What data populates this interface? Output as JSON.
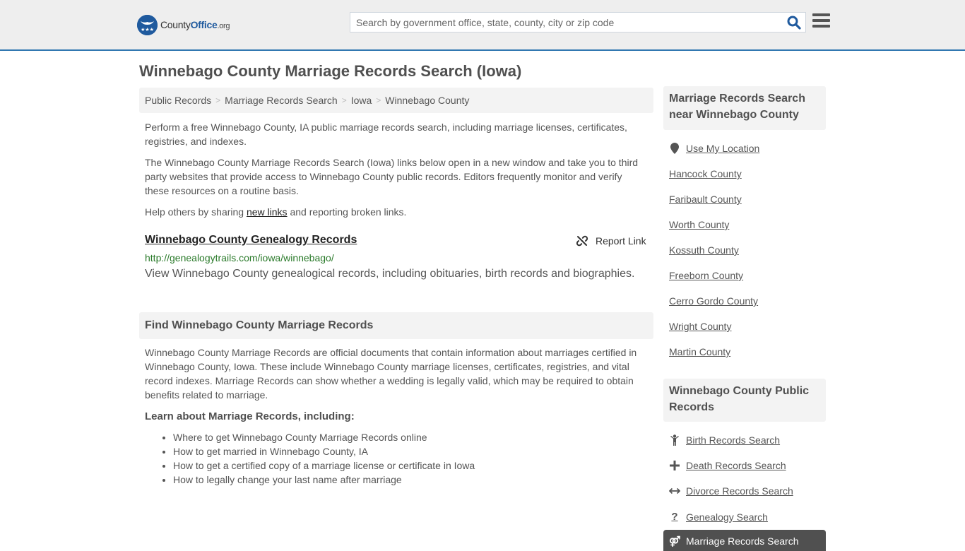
{
  "header": {
    "logo": {
      "name": "County",
      "name_accent": "Office",
      "tld": ".org"
    },
    "search": {
      "placeholder": "Search by government office, state, county, city or zip code",
      "value": ""
    },
    "colors": {
      "brand": "#1f5a9e",
      "header_border": "#3178b1"
    }
  },
  "page": {
    "title": "Winnebago County Marriage Records Search (Iowa)",
    "breadcrumb": [
      "Public Records",
      "Marriage Records Search",
      "Iowa",
      "Winnebago County"
    ],
    "intro": "Perform a free Winnebago County, IA public marriage records search, including marriage licenses, certificates, registries, and indexes.",
    "disclaimer": "The Winnebago County Marriage Records Search (Iowa) links below open in a new window and take you to third party websites that provide access to Winnebago County public records. Editors frequently monitor and verify these resources on a routine basis.",
    "help": {
      "prefix": "Help others by sharing ",
      "link": "new links",
      "suffix": " and reporting broken links."
    }
  },
  "result": {
    "title": "Winnebago County Genealogy Records",
    "report_label": "Report Link",
    "url": "http://genealogytrails.com/iowa/winnebago/",
    "description": "View Winnebago County genealogical records, including obituaries, birth records and biographies."
  },
  "find_section": {
    "heading": "Find Winnebago County Marriage Records",
    "body": "Winnebago County Marriage Records are official documents that contain information about marriages certified in Winnebago County, Iowa. These include Winnebago County marriage licenses, certificates, registries, and vital record indexes. Marriage Records can show whether a wedding is legally valid, which may be required to obtain benefits related to marriage.",
    "learn_heading": "Learn about Marriage Records, including:",
    "bullets": [
      "Where to get Winnebago County Marriage Records online",
      "How to get married in Winnebago County, IA",
      "How to get a certified copy of a marriage license or certificate in Iowa",
      "How to legally change your last name after marriage"
    ]
  },
  "sidebar": {
    "nearby": {
      "heading": "Marriage Records Search near Winnebago County",
      "location_label": "Use My Location",
      "counties": [
        "Hancock County",
        "Faribault County",
        "Worth County",
        "Kossuth County",
        "Freeborn County",
        "Cerro Gordo County",
        "Wright County",
        "Martin County"
      ]
    },
    "public_records": {
      "heading": "Winnebago County Public Records",
      "items": [
        {
          "label": "Birth Records Search",
          "icon": "child-icon"
        },
        {
          "label": "Death Records Search",
          "icon": "plus-icon"
        },
        {
          "label": "Divorce Records Search",
          "icon": "arrows-h-icon"
        },
        {
          "label": "Genealogy Search",
          "icon": "question-icon"
        },
        {
          "label": "Marriage Records Search",
          "icon": "marriage-icon",
          "active": true
        }
      ]
    }
  }
}
